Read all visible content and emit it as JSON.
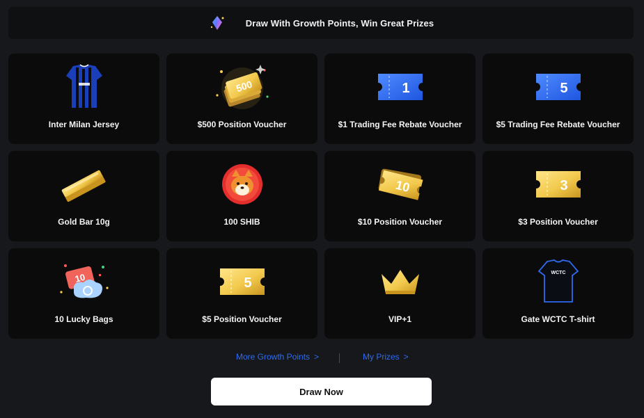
{
  "banner": {
    "text": "Draw With Growth Points, Win Great Prizes",
    "icon": "sparkle-gem-icon"
  },
  "prizes": [
    {
      "label": "Inter Milan Jersey",
      "icon": "football-jersey-icon"
    },
    {
      "label": "$500 Position Voucher",
      "icon": "voucher-stack-icon",
      "art_text": "500"
    },
    {
      "label": "$1 Trading Fee Rebate Voucher",
      "icon": "blue-ticket-icon",
      "art_text": "1"
    },
    {
      "label": "$5 Trading Fee Rebate Voucher",
      "icon": "blue-ticket-icon",
      "art_text": "5"
    },
    {
      "label": "Gold Bar 10g",
      "icon": "gold-bar-icon"
    },
    {
      "label": "100 SHIB",
      "icon": "shib-coin-icon"
    },
    {
      "label": "$10 Position Voucher",
      "icon": "gold-ticket-stack-icon",
      "art_text": "10"
    },
    {
      "label": "$3 Position Voucher",
      "icon": "gold-ticket-icon",
      "art_text": "3"
    },
    {
      "label": "10 Lucky Bags",
      "icon": "lucky-bag-icon",
      "art_text": "10"
    },
    {
      "label": "$5 Position Voucher",
      "icon": "gold-ticket-icon",
      "art_text": "5"
    },
    {
      "label": "VIP+1",
      "icon": "crown-icon"
    },
    {
      "label": "Gate WCTC T-shirt",
      "icon": "tshirt-icon",
      "art_text": "WCTC"
    }
  ],
  "links": {
    "more_growth_points": "More Growth Points",
    "my_prizes": "My Prizes",
    "chevron": ">"
  },
  "draw_button": "Draw Now",
  "colors": {
    "background": "#17181b",
    "card": "#0b0b0c",
    "link": "#2e6bf0",
    "gold": "#f2c94c",
    "blue_ticket": "#2f6df0"
  }
}
